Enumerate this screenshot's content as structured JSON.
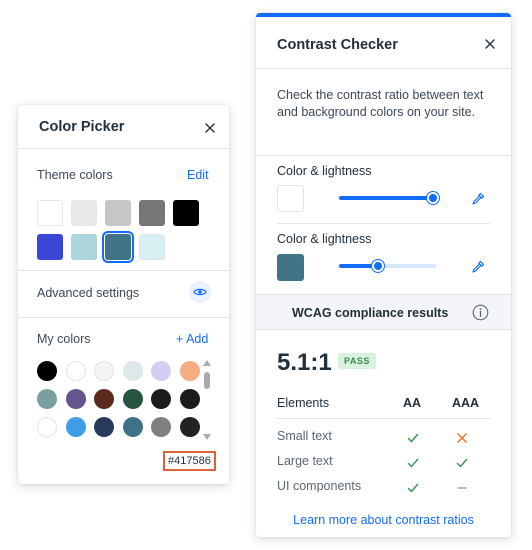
{
  "color_picker": {
    "title": "Color Picker",
    "theme_colors_label": "Theme colors",
    "edit_label": "Edit",
    "theme_swatches": [
      {
        "color": "#ffffff",
        "selected": false
      },
      {
        "color": "#e8e8e8",
        "selected": false
      },
      {
        "color": "#c6c6c6",
        "selected": false
      },
      {
        "color": "#767676",
        "selected": false
      },
      {
        "color": "#000000",
        "selected": false
      },
      {
        "color": "#3b46d6",
        "selected": false
      },
      {
        "color": "#acd5dd",
        "selected": false
      },
      {
        "color": "#417586",
        "selected": true
      },
      {
        "color": "#d8eff4",
        "selected": false
      }
    ],
    "advanced_settings_label": "Advanced settings",
    "my_colors_label": "My colors",
    "add_label": "+ Add",
    "my_colors": [
      "#000000",
      "#ffffff",
      "#f5f5f5",
      "#dde9e8",
      "#d6cdf4",
      "#f6ad82",
      "#7a9ea1",
      "#655690",
      "#5a2b1c",
      "#255441",
      "#1c1c1c",
      "#1c1c1c",
      "#ffffff",
      "#3f9de8",
      "#283a5c",
      "#3f7286",
      "#7f7f7f",
      "#222222"
    ],
    "hex_value": "#417586"
  },
  "contrast_checker": {
    "title": "Contrast Checker",
    "description": "Check the contrast ratio between text and background colors on your site.",
    "color1": {
      "label": "Color & lightness",
      "color": "#ffffff",
      "lightness": 0.97
    },
    "color2": {
      "label": "Color & lightness",
      "color": "#417586",
      "lightness": 0.4
    },
    "wcag_title": "WCAG compliance results",
    "ratio": "5.1:1",
    "status": "PASS",
    "table": {
      "headers": [
        "Elements",
        "AA",
        "AAA"
      ],
      "rows": [
        {
          "label": "Small text",
          "aa": "pass",
          "aaa": "fail"
        },
        {
          "label": "Large text",
          "aa": "pass",
          "aaa": "pass"
        },
        {
          "label": "UI components",
          "aa": "pass",
          "aaa": "na"
        }
      ]
    },
    "learn_more": "Learn more about contrast ratios"
  },
  "colors": {
    "accent": "#116dff",
    "pass": "#3a9a55",
    "fail": "#e8742c",
    "na": "#a0a7ad",
    "hex_highlight": "#e0623c"
  }
}
